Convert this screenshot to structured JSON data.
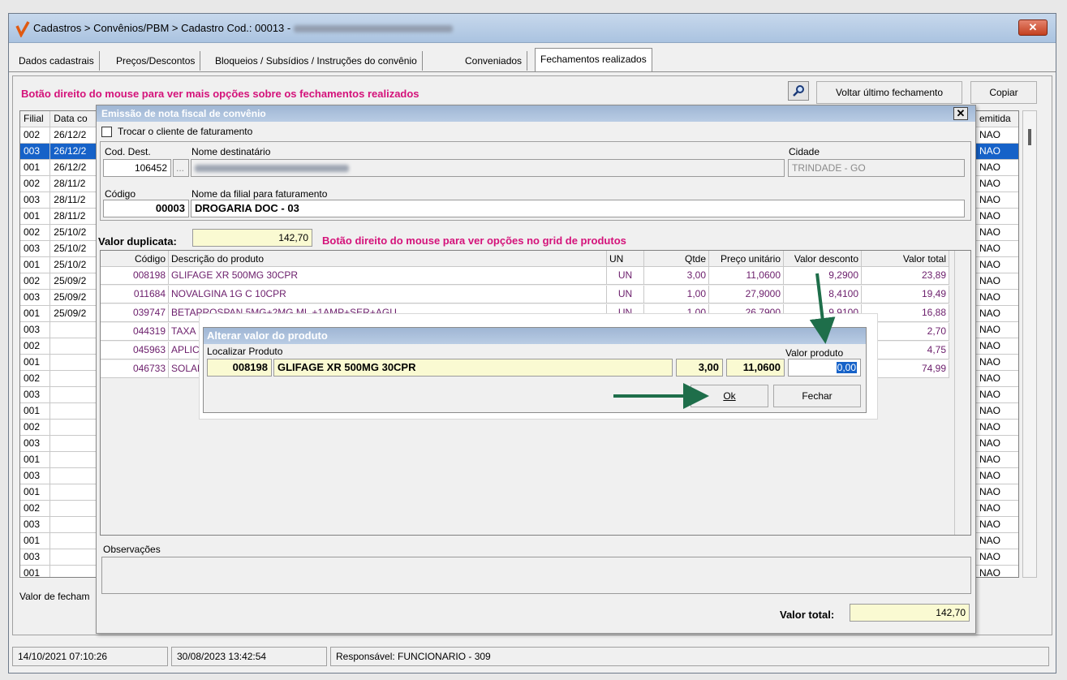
{
  "window": {
    "title_prefix": "Cadastros > Convênios/PBM > Cadastro  Cod.: 00013 - ",
    "close_label": "✕"
  },
  "tabs": [
    {
      "label": "Dados cadastrais"
    },
    {
      "label": "Preços/Descontos"
    },
    {
      "label": "Bloqueios / Subsídios / Instruções do convênio"
    },
    {
      "label": "Conveniados"
    },
    {
      "label": "Fechamentos realizados"
    }
  ],
  "fechamentos": {
    "hint": "Botão direito do mouse para ver mais opções sobre os fechamentos realizados",
    "voltar_label": "Voltar último fechamento",
    "copiar_label": "Copiar",
    "columns": {
      "filial": "Filial",
      "data": "Data co",
      "emitida": "emitida"
    },
    "rows": [
      {
        "filial": "002",
        "data": "26/12/2"
      },
      {
        "filial": "003",
        "data": "26/12/2"
      },
      {
        "filial": "001",
        "data": "26/12/2"
      },
      {
        "filial": "002",
        "data": "28/11/2"
      },
      {
        "filial": "003",
        "data": "28/11/2"
      },
      {
        "filial": "001",
        "data": "28/11/2"
      },
      {
        "filial": "002",
        "data": "25/10/2"
      },
      {
        "filial": "003",
        "data": "25/10/2"
      },
      {
        "filial": "001",
        "data": "25/10/2"
      },
      {
        "filial": "002",
        "data": "25/09/2"
      },
      {
        "filial": "003",
        "data": "25/09/2"
      },
      {
        "filial": "001",
        "data": "25/09/2"
      },
      {
        "filial": "003",
        "data": ""
      },
      {
        "filial": "002",
        "data": ""
      },
      {
        "filial": "001",
        "data": ""
      },
      {
        "filial": "002",
        "data": ""
      },
      {
        "filial": "003",
        "data": ""
      },
      {
        "filial": "001",
        "data": ""
      },
      {
        "filial": "002",
        "data": ""
      },
      {
        "filial": "003",
        "data": ""
      },
      {
        "filial": "001",
        "data": ""
      },
      {
        "filial": "003",
        "data": ""
      },
      {
        "filial": "001",
        "data": ""
      },
      {
        "filial": "002",
        "data": ""
      },
      {
        "filial": "003",
        "data": ""
      },
      {
        "filial": "001",
        "data": ""
      },
      {
        "filial": "003",
        "data": ""
      },
      {
        "filial": "001",
        "data": ""
      }
    ],
    "emitida_value": "NAO",
    "valor_fechamento_label": "Valor de fecham"
  },
  "statusbar": {
    "s1": "14/10/2021 07:10:26",
    "s2": "30/08/2023 13:42:54",
    "s3": "Responsável: FUNCIONARIO - 309"
  },
  "emissao": {
    "title": "Emissão de nota fiscal de convênio",
    "close_label": "✕",
    "trocar_label": "Trocar o cliente de faturamento",
    "cod_dest_label": "Cod. Dest.",
    "cod_dest_value": "106452",
    "ellipsis": "...",
    "nome_dest_label": "Nome destinatário",
    "cidade_label": "Cidade",
    "cidade_value": "TRINDADE - GO",
    "codigo_label": "Código",
    "codigo_value": "00003",
    "nome_filial_label": "Nome da filial para faturamento",
    "nome_filial_value": "DROGARIA DOC - 03",
    "valor_dup_label": "Valor duplicata:",
    "valor_dup_value": "142,70",
    "hint_prod": "Botão direito do mouse para ver opções no grid de produtos",
    "prod_columns": {
      "codigo": "Código",
      "descricao": "Descrição do produto",
      "un": "UN",
      "qtde": "Qtde",
      "preco": "Preço unitário",
      "desconto": "Valor desconto",
      "total": "Valor total"
    },
    "produtos": [
      {
        "codigo": "008198",
        "descricao": "GLIFAGE XR 500MG 30CPR",
        "un": "UN",
        "qtde": "3,00",
        "preco": "11,0600",
        "desconto": "9,2900",
        "total": "23,89"
      },
      {
        "codigo": "011684",
        "descricao": "NOVALGINA 1G C 10CPR",
        "un": "UN",
        "qtde": "1,00",
        "preco": "27,9000",
        "desconto": "8,4100",
        "total": "19,49"
      },
      {
        "codigo": "039747",
        "descricao": "BETAPROSPAN 5MG+2MG ML +1AMP+SER+AGU",
        "un": "UN",
        "qtde": "1,00",
        "preco": "26,7900",
        "desconto": "9,9100",
        "total": "16,88"
      },
      {
        "codigo": "044319",
        "descricao": "TAXA D",
        "un": "",
        "qtde": "",
        "preco": "",
        "desconto": "",
        "total": "2,70"
      },
      {
        "codigo": "045963",
        "descricao": "APLICA",
        "un": "",
        "qtde": "",
        "preco": "",
        "desconto": "",
        "total": "4,75"
      },
      {
        "codigo": "046733",
        "descricao": "SOLAR",
        "un": "",
        "qtde": "",
        "preco": "",
        "desconto": "",
        "total": "74,99"
      }
    ],
    "obs_label": "Observações",
    "valor_total_label": "Valor total:",
    "valor_total_value": "142,70"
  },
  "alterar": {
    "title": "Alterar valor do produto",
    "localizar_label": "Localizar Produto",
    "codigo": "008198",
    "descricao": "GLIFAGE XR 500MG 30CPR",
    "qtde": "3,00",
    "preco": "11,0600",
    "valor_label": "Valor produto",
    "valor_value": "0,00",
    "ok_label": "Ok",
    "fechar_label": "Fechar"
  },
  "colors": {
    "accent_pink": "#d4127a",
    "selection_blue": "#1662c8",
    "dialog_title": "#9fb6d4",
    "arrow_green": "#1e6e4a"
  },
  "icons": [
    "app-logo-icon",
    "search-icon",
    "close-icon",
    "checkbox-icon",
    "arrow-annotation-icon"
  ]
}
